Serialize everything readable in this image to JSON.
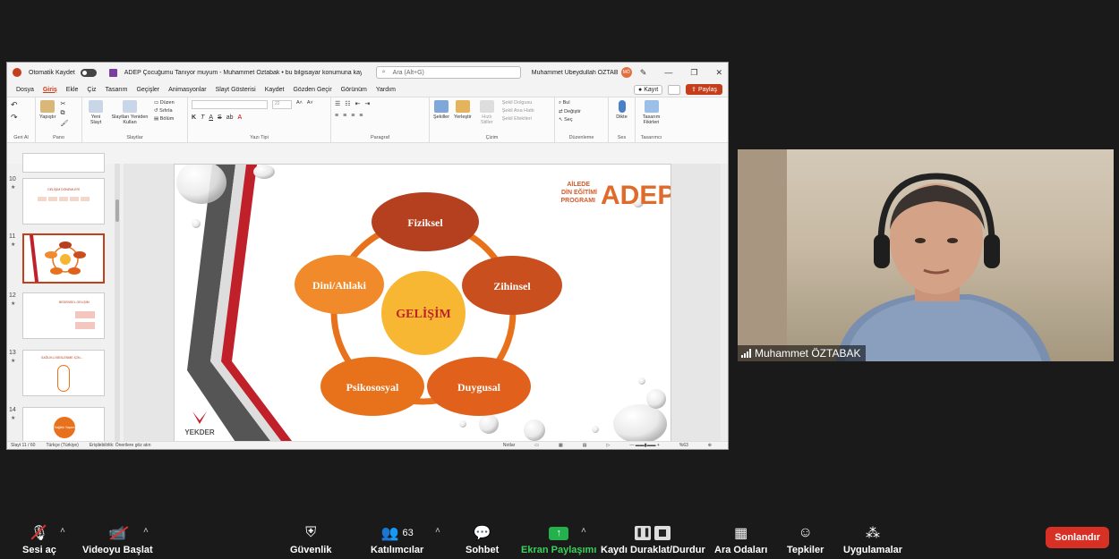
{
  "ppt": {
    "autosave_label": "Otomatik Kaydet",
    "doc_title": "ADEP Çocuğumu Tanıyor muyum - Muhammet Öztabak • bu bilgisayar konumuna kaydedildi ˅",
    "search_placeholder": "Ara (Alt+G)",
    "user_name": "Muhammet Übeydullah ÖZTABAK",
    "user_initials": "MÖ",
    "menu": [
      "Dosya",
      "Giriş",
      "Ekle",
      "Çiz",
      "Tasarım",
      "Geçişler",
      "Animasyonlar",
      "Slayt Gösterisi",
      "Kaydet",
      "Gözden Geçir",
      "Görünüm",
      "Yardım"
    ],
    "record_label": "Kayıt",
    "share_label": "Paylaş",
    "ribbon": {
      "undo_group": "Geri Al",
      "paste": "Yapıştır",
      "clipboard_group": "Pano",
      "new_slide": "Yeni Slayt",
      "reuse_slides": "Slaytları Yeniden Kullan",
      "layout": "Düzen",
      "reset": "Sıfırla",
      "section": "Bölüm",
      "slides_group": "Slaytlar",
      "font_size": "22",
      "font_group": "Yazı Tipi",
      "paragraph_group": "Paragraf",
      "shapes": "Şekiller",
      "arrange": "Yerleştir",
      "quick_styles": "Hızlı Stiller",
      "shape_fill": "Şekil Dolgusu",
      "shape_outline": "Şekil Ana Hattı",
      "shape_effects": "Şekil Efektleri",
      "drawing_group": "Çizim",
      "find": "Bul",
      "replace": "Değiştir",
      "select": "Seç",
      "editing_group": "Düzenleme",
      "dictate": "Dikte",
      "voice_group": "Ses",
      "designer": "Tasarım Fikirleri",
      "designer_group": "Tasarımcı"
    },
    "thumbs": [
      {
        "num": "10",
        "title": "GELİŞİM DÖNEMLERİ"
      },
      {
        "num": "11",
        "title": ""
      },
      {
        "num": "12",
        "title": "BEDENSEL GELİŞİM"
      },
      {
        "num": "13",
        "title": "SAĞLIKLI BESLENME İÇİN..."
      },
      {
        "num": "14",
        "title": "Sağlıklı Yaşam"
      }
    ],
    "slide": {
      "logo_small1": "AİLEDE",
      "logo_small2": "DİN EĞİTİMİ",
      "logo_small3": "PROGRAMI",
      "logo_big": "ADEP",
      "center": "GELİŞİM",
      "nodes": [
        "Fiziksel",
        "Zihinsel",
        "Duygusal",
        "Psikososyal",
        "Dini/Ahlaki"
      ],
      "footer_logo": "YEKDER"
    },
    "status": {
      "slide_count": "Slayt 11 / 60",
      "language": "Türkçe (Türkiye)",
      "accessibility": "Erişilebilirlik: Önerilere göz atın",
      "notes": "Notlar",
      "zoom": "%63"
    }
  },
  "video": {
    "participant_name": "Muhammet ÖZTABAK"
  },
  "zoom_toolbar": {
    "audio": "Sesi aç",
    "video": "Videoyu Başlat",
    "security": "Güvenlik",
    "participants": "Katılımcılar",
    "participants_count": "63",
    "chat": "Sohbet",
    "share": "Ekran Paylaşımı",
    "record": "Kaydı Duraklat/Durdur",
    "breakout": "Ara Odaları",
    "reactions": "Tepkiler",
    "apps": "Uygulamalar",
    "end": "Sonlandır"
  },
  "colors": {
    "ppt_accent": "#c43e1c",
    "node_dark": "#b5401f",
    "node_orange": "#e8721c",
    "center_fill": "#f7b733",
    "share_green": "#22b14c",
    "end_red": "#d93025"
  }
}
